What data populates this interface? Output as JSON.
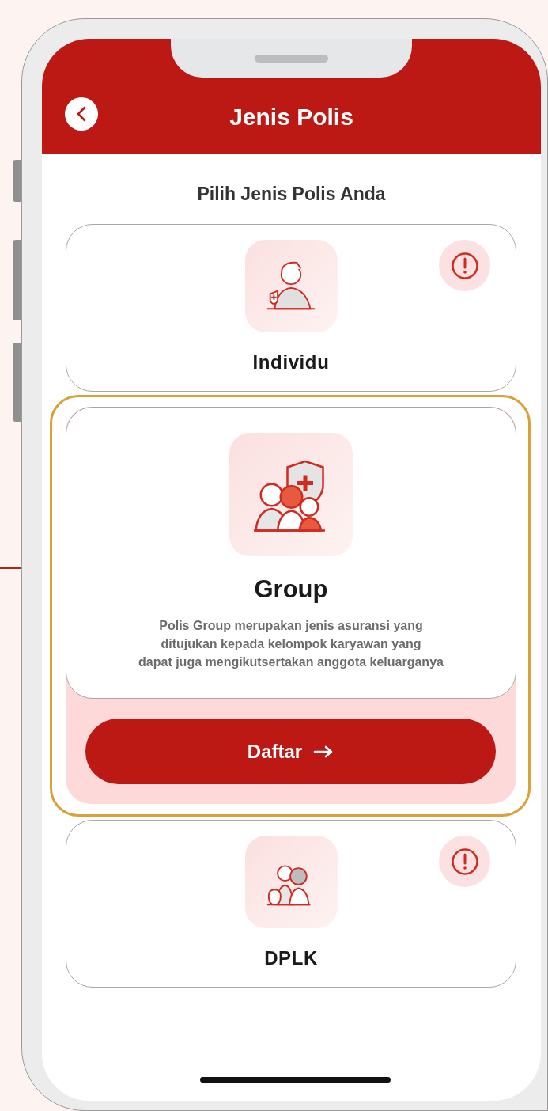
{
  "header": {
    "title": "Jenis Polis"
  },
  "heading": "Pilih Jenis Polis Anda",
  "policies": [
    {
      "kind": "individual",
      "title": "Individu",
      "selected": false,
      "info": true
    },
    {
      "kind": "group",
      "title": "Group",
      "selected": true,
      "info": false,
      "description_lines": [
        "Polis Group merupakan jenis asuransi yang",
        "ditujukan kepada kelompok karyawan yang",
        "dapat juga mengikutsertakan anggota keluarganya"
      ],
      "action": "Daftar"
    },
    {
      "kind": "pension",
      "title": "DPLK",
      "selected": false,
      "info": true
    }
  ]
}
